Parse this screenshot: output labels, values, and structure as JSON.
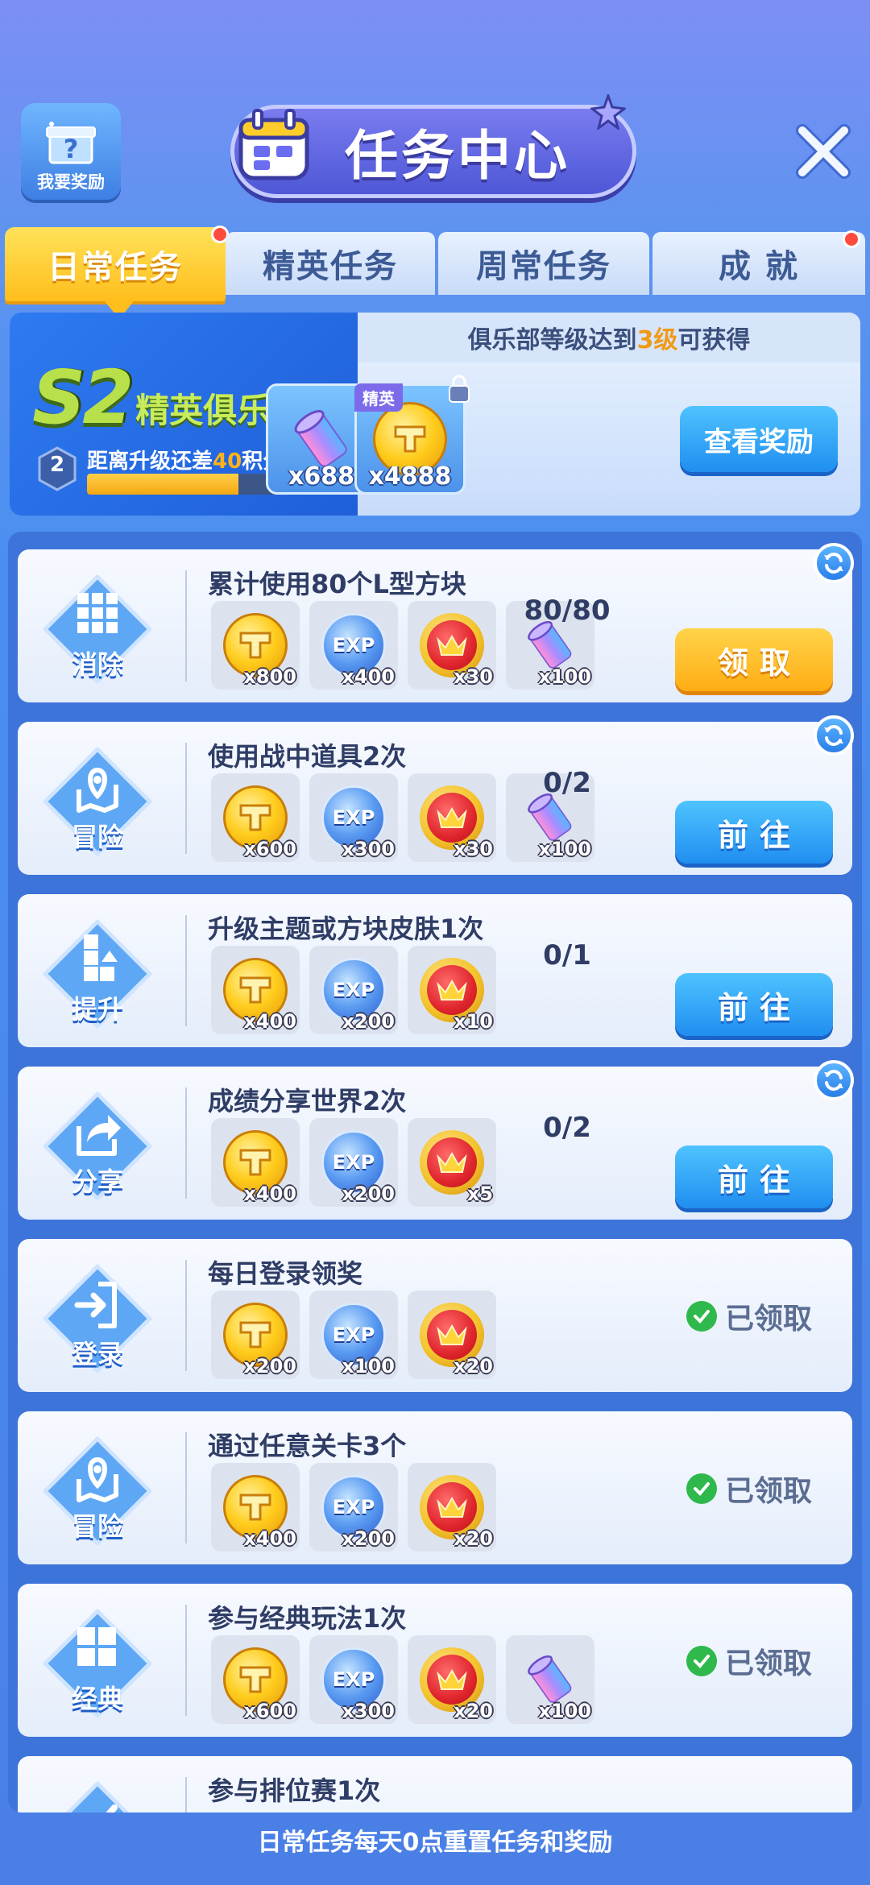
{
  "header": {
    "reward_button_label": "我要奖励",
    "title": "任务中心"
  },
  "tabs": [
    {
      "label": "日常任务",
      "active": true,
      "red_dot": true
    },
    {
      "label": "精英任务",
      "active": false,
      "red_dot": false
    },
    {
      "label": "周常任务",
      "active": false,
      "red_dot": false
    },
    {
      "label": "成 就",
      "active": false,
      "red_dot": true
    }
  ],
  "club": {
    "name_number": "S2",
    "name_text": "精英俱乐部",
    "level": "2",
    "progress_prefix": "距离升级还差",
    "points_needed": "40",
    "progress_suffix": "积分",
    "progress_fraction": 0.6,
    "requirement_prefix": "俱乐部等级达到",
    "requirement_level": "3级",
    "requirement_suffix": "可获得",
    "items": [
      {
        "icon": "gem-icon",
        "qty": "x688",
        "elite_tag": ""
      },
      {
        "icon": "coin-icon",
        "qty": "x4888",
        "elite_tag": "精英"
      }
    ],
    "view_button": "查看奖励"
  },
  "tasks": [
    {
      "icon": "grid-icon",
      "icon_label": "消除",
      "title": "累计使用80个L型方块",
      "rewards": [
        {
          "type": "coin",
          "qty": "x800"
        },
        {
          "type": "exp",
          "qty": "x400"
        },
        {
          "type": "crown",
          "qty": "x30"
        },
        {
          "type": "gem",
          "qty": "x100"
        }
      ],
      "progress": "80/80",
      "status": "claim",
      "button": "领取",
      "refresh": true
    },
    {
      "icon": "map-pin-icon",
      "icon_label": "冒险",
      "title": "使用战中道具2次",
      "rewards": [
        {
          "type": "coin",
          "qty": "x600"
        },
        {
          "type": "exp",
          "qty": "x300"
        },
        {
          "type": "crown",
          "qty": "x30"
        },
        {
          "type": "gem",
          "qty": "x100"
        }
      ],
      "progress": "0/2",
      "status": "go",
      "button": "前往",
      "refresh": true
    },
    {
      "icon": "blocks-up-icon",
      "icon_label": "提升",
      "title": "升级主题或方块皮肤1次",
      "rewards": [
        {
          "type": "coin",
          "qty": "x400"
        },
        {
          "type": "exp",
          "qty": "x200"
        },
        {
          "type": "crown",
          "qty": "x10"
        }
      ],
      "progress": "0/1",
      "status": "go",
      "button": "前往",
      "refresh": false
    },
    {
      "icon": "share-icon",
      "icon_label": "分享",
      "title": "成绩分享世界2次",
      "rewards": [
        {
          "type": "coin",
          "qty": "x400"
        },
        {
          "type": "exp",
          "qty": "x200"
        },
        {
          "type": "crown",
          "qty": "x5"
        }
      ],
      "progress": "0/2",
      "status": "go",
      "button": "前往",
      "refresh": true
    },
    {
      "icon": "login-icon",
      "icon_label": "登录",
      "title": "每日登录领奖",
      "rewards": [
        {
          "type": "coin",
          "qty": "x200"
        },
        {
          "type": "exp",
          "qty": "x100"
        },
        {
          "type": "crown",
          "qty": "x20"
        }
      ],
      "progress": "",
      "status": "claimed",
      "button": "已领取",
      "refresh": false
    },
    {
      "icon": "map-pin-icon",
      "icon_label": "冒险",
      "title": "通过任意关卡3个",
      "rewards": [
        {
          "type": "coin",
          "qty": "x400"
        },
        {
          "type": "exp",
          "qty": "x200"
        },
        {
          "type": "crown",
          "qty": "x20"
        }
      ],
      "progress": "",
      "status": "claimed",
      "button": "已领取",
      "refresh": false
    },
    {
      "icon": "classic-grid-icon",
      "icon_label": "经典",
      "title": "参与经典玩法1次",
      "rewards": [
        {
          "type": "coin",
          "qty": "x600"
        },
        {
          "type": "exp",
          "qty": "x300"
        },
        {
          "type": "crown",
          "qty": "x20"
        },
        {
          "type": "gem",
          "qty": "x100"
        }
      ],
      "progress": "",
      "status": "claimed",
      "button": "已领取",
      "refresh": false
    },
    {
      "icon": "rank-icon",
      "icon_label": "",
      "title": "参与排位赛1次",
      "rewards": [],
      "progress": "",
      "status": "none",
      "button": "",
      "refresh": false
    }
  ],
  "footer": "日常任务每天0点重置任务和奖励",
  "colors": {
    "accent_gold": "#ffbe1c",
    "accent_blue": "#1f8ef0",
    "success_green": "#2fb84b"
  }
}
